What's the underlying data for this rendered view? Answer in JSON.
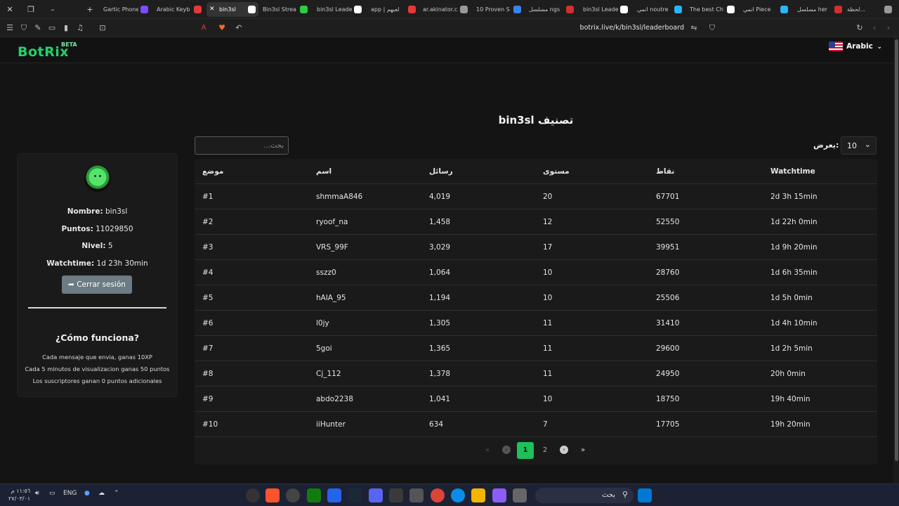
{
  "browser": {
    "tabs": [
      {
        "label": "Gartic Phone",
        "color": "#7c4dff"
      },
      {
        "label": "Arabic Keyb",
        "color": "#e53935"
      },
      {
        "label": "bin3sl",
        "color": "#ffffff",
        "active": true
      },
      {
        "label": "Bin3sl Strea",
        "color": "#2ecc40"
      },
      {
        "label": "bin3sl Leade",
        "color": "#ffffff"
      },
      {
        "label": "app | لعبهم",
        "color": "#e53935"
      },
      {
        "label": "ar.akinator.c",
        "color": "#999999"
      },
      {
        "label": "10 Proven S",
        "color": "#3b82f6"
      },
      {
        "label": "مسلسل ngs",
        "color": "#d32f2f"
      },
      {
        "label": "bin3sl Leade",
        "color": "#ffffff"
      },
      {
        "label": "انمي noutre",
        "color": "#29b6f6"
      },
      {
        "label": "The best Ch",
        "color": "#ffffff"
      },
      {
        "label": "انمي Piece",
        "color": "#29b6f6"
      },
      {
        "label": "مسلسل her",
        "color": "#d32f2f"
      },
      {
        "label": "لحظة...",
        "color": "#999999"
      }
    ],
    "url": "botrix.live/k/bin3sl/leaderboard"
  },
  "header": {
    "logo": "BotRix",
    "beta": "BETA",
    "language": "Arabic"
  },
  "page": {
    "title": "bin3sl تصنيف",
    "search_placeholder": "...بحث",
    "show_label": "يعرض:",
    "per_page": "10"
  },
  "profile": {
    "name_label": "Nombre:",
    "name_value": "bin3sl",
    "points_label": "Puntos:",
    "points_value": "11029850",
    "level_label": "Nivel:",
    "level_value": "5",
    "watchtime_label": "Watchtime:",
    "watchtime_value": "1d 23h 30min",
    "logout_label": "Cerrar sesión",
    "how_title": "¿Cómo funciona?",
    "how_lines": [
      "Cada mensaje que envia, ganas 10XP",
      "Cada 5 minutos de visualizacion ganas 50 puntos",
      "Los suscriptores ganan 0 puntos adicionales"
    ]
  },
  "table": {
    "headers": [
      "موضع",
      "اسم",
      "رسائل",
      "مستوى",
      "نقاط",
      "Watchtime"
    ],
    "rows": [
      [
        "#1",
        "shmmaA846",
        "4,019",
        "20",
        "67701",
        "2d 3h 15min"
      ],
      [
        "#2",
        "ryoof_na",
        "1,458",
        "12",
        "52550",
        "1d 22h 0min"
      ],
      [
        "#3",
        "VRS_99F",
        "3,029",
        "17",
        "39951",
        "1d 9h 20min"
      ],
      [
        "#4",
        "sszz0",
        "1,064",
        "10",
        "28760",
        "1d 6h 35min"
      ],
      [
        "#5",
        "hAlA_95",
        "1,194",
        "10",
        "25506",
        "1d 5h 0min"
      ],
      [
        "#6",
        "l0jy",
        "1,305",
        "11",
        "31410",
        "1d 4h 10min"
      ],
      [
        "#7",
        "5goi",
        "1,365",
        "11",
        "29600",
        "1d 2h 5min"
      ],
      [
        "#8",
        "Cj_112",
        "1,378",
        "11",
        "24950",
        "20h 0min"
      ],
      [
        "#9",
        "abdo2238",
        "1,041",
        "10",
        "18750",
        "19h 40min"
      ],
      [
        "#10",
        "iiHunter",
        "634",
        "7",
        "17705",
        "19h 20min"
      ]
    ]
  },
  "pagination": {
    "first": "«",
    "prev": "‹",
    "pages": [
      "1",
      "2"
    ],
    "current": "1",
    "next": "›",
    "last": "»"
  },
  "taskbar": {
    "search_label": "بحث",
    "language": "ENG",
    "time": "١١:٥٦ م",
    "date": "٢٧/٠٣/٠١"
  }
}
